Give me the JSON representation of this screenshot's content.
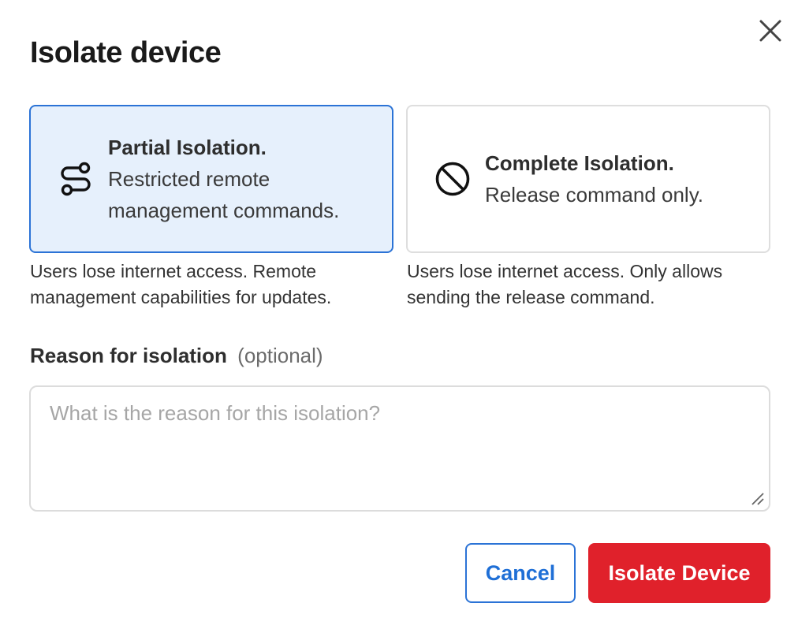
{
  "dialog": {
    "title": "Isolate device",
    "close_icon": "close-icon"
  },
  "options": [
    {
      "id": "partial",
      "icon": "route-icon",
      "heading": "Partial Isolation.",
      "subtitle_line1": "Restricted remote",
      "subtitle_line2": "management commands.",
      "selected": true,
      "description_line1": "Users lose internet access. Remote",
      "description_line2": "management capabilities for updates."
    },
    {
      "id": "complete",
      "icon": "block-icon",
      "heading": "Complete Isolation.",
      "subtitle_line1": "Release command only.",
      "selected": false,
      "description_line1": "Users lose internet access. Only allows",
      "description_line2": "sending the release command."
    }
  ],
  "reason": {
    "label": "Reason for isolation",
    "optional_label": "(optional)",
    "placeholder": "What is the reason for this isolation?",
    "value": ""
  },
  "actions": {
    "cancel_label": "Cancel",
    "isolate_label": "Isolate Device"
  },
  "colors": {
    "accent_blue": "#2b73d6",
    "selected_bg": "#e6f0fc",
    "danger_red": "#e0212b"
  }
}
